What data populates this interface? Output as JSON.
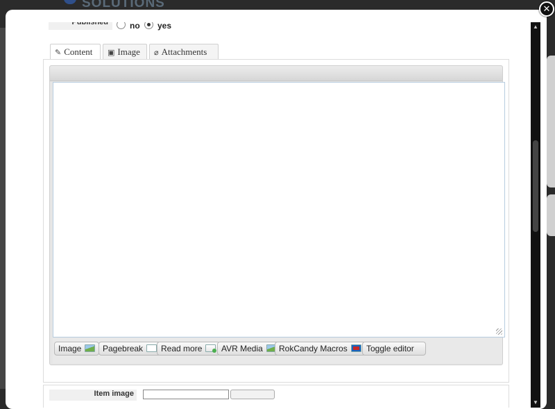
{
  "background": {
    "brand_text": "SOLUTIONS"
  },
  "modal": {
    "close_glyph": "✕",
    "published": {
      "label": "Published",
      "options": [
        {
          "label": "no",
          "checked": false
        },
        {
          "label": "yes",
          "checked": true
        }
      ]
    },
    "tabs": [
      {
        "icon": "✎",
        "icon_name": "edit-icon",
        "label": "Content",
        "active": true
      },
      {
        "icon": "▣",
        "icon_name": "image-icon",
        "label": "Image",
        "active": false
      },
      {
        "icon": "⌀",
        "icon_name": "paperclip-icon",
        "label": "Attachments",
        "active": false
      }
    ],
    "editor": {
      "buttons": [
        {
          "label": "Image",
          "icon_name": "image-icon"
        },
        {
          "label": "Pagebreak",
          "icon_name": "pagebreak-icon"
        },
        {
          "label": "Read more",
          "icon_name": "readmore-icon"
        },
        {
          "label": "AVR Media",
          "icon_name": "media-icon"
        },
        {
          "label": "RokCandy Macros",
          "icon_name": "rokcandy-icon"
        },
        {
          "label": "Toggle editor",
          "icon_name": ""
        }
      ]
    },
    "item_image": {
      "label": "Item image"
    },
    "scrollbar": {
      "up_glyph": "▲",
      "down_glyph": "▼"
    }
  }
}
